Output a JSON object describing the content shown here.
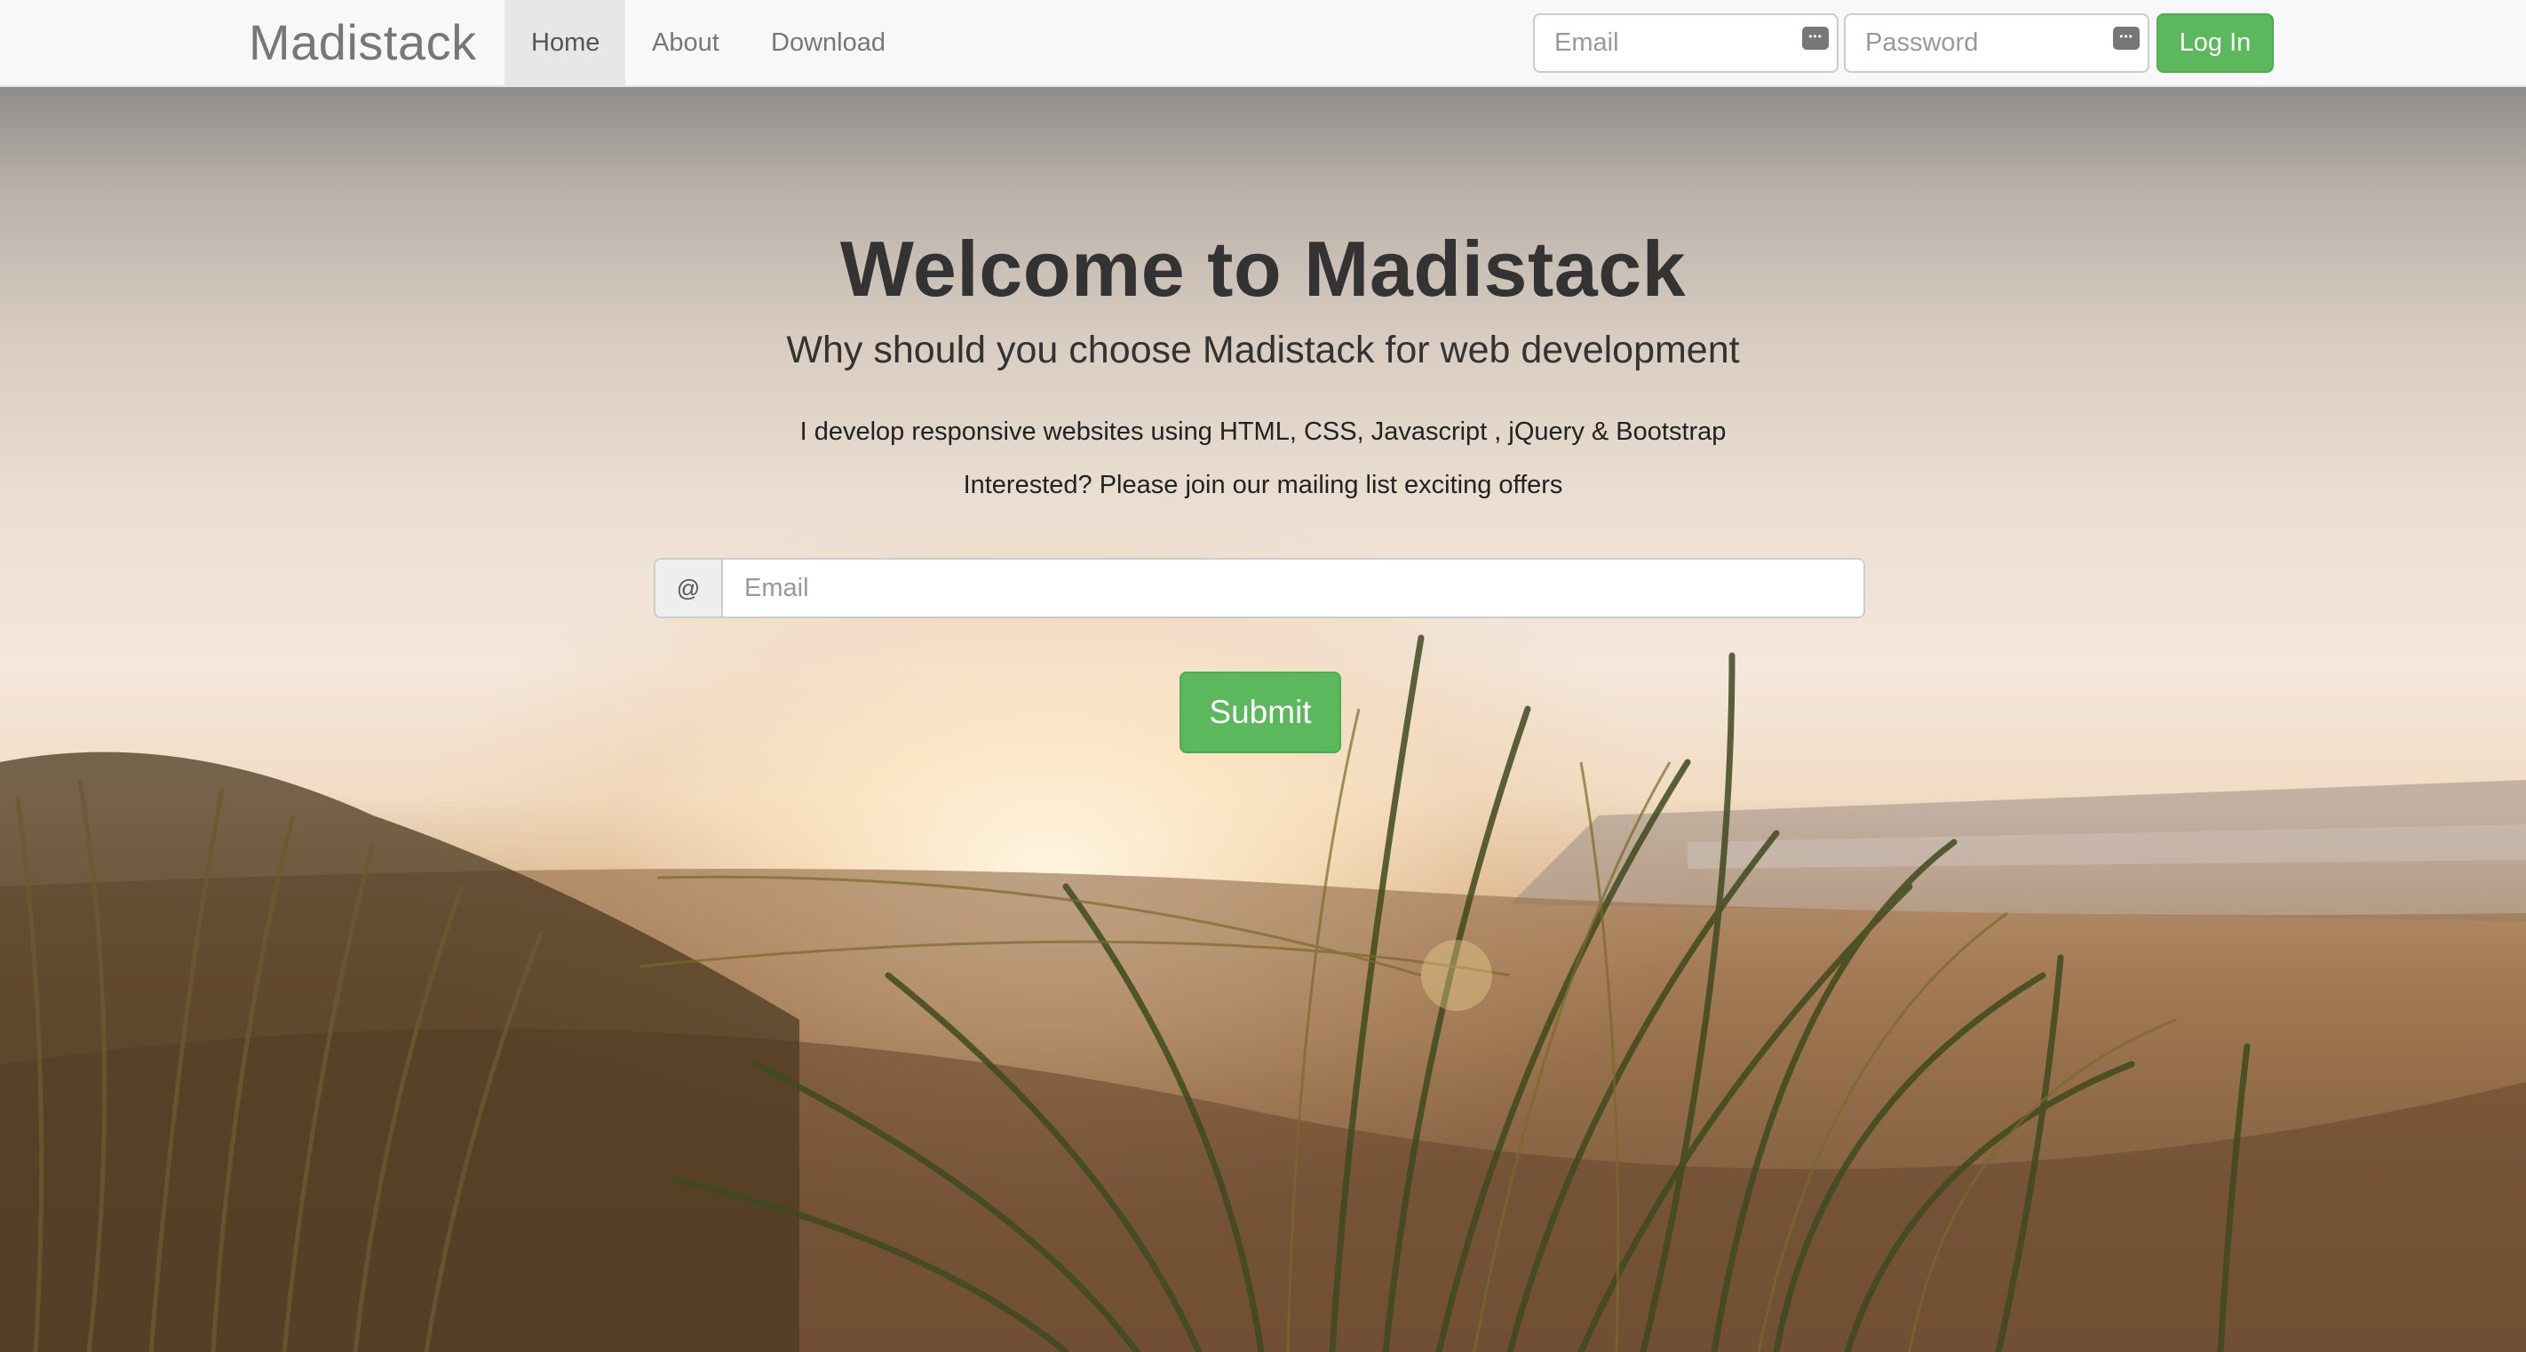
{
  "navbar": {
    "brand": "Madistack",
    "links": [
      {
        "label": "Home",
        "active": true
      },
      {
        "label": "About",
        "active": false
      },
      {
        "label": "Download",
        "active": false
      }
    ],
    "login_form": {
      "email_placeholder": "Email",
      "password_placeholder": "Password",
      "submit_label": "Log In"
    }
  },
  "hero": {
    "title": "Welcome to Madistack",
    "subtitle": "Why should you choose Madistack for web development",
    "lines": [
      "I develop responsive websites using HTML, CSS, Javascript , jQuery & Bootstrap",
      "Interested? Please join our mailing list exciting offers"
    ],
    "signup": {
      "addon": "@",
      "email_placeholder": "Email",
      "submit_label": "Submit"
    },
    "background_image": "beach-grass-sunset"
  },
  "colors": {
    "success": "#5cb85c",
    "navbar_bg": "#f8f8f8",
    "text_dark": "#333333"
  }
}
